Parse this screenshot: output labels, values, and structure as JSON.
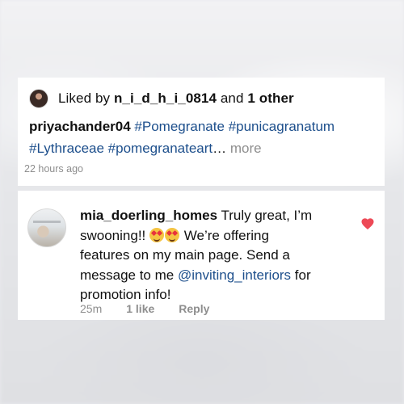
{
  "post": {
    "liked_prefix": "Liked by ",
    "liked_user": "n_i_d_h_i_0814",
    "liked_and": " and ",
    "liked_count": "1 other",
    "caption_user": "priyachander04",
    "caption_tags": [
      "#Pomegranate",
      "#punicagranatum",
      "#Lythraceae",
      "#pomegranateart"
    ],
    "caption_ellipsis": "…",
    "more_label": "more",
    "time": "22 hours ago"
  },
  "comment": {
    "user": "mia_doerling_homes",
    "text_1": "Truly great, I’m swooning!!",
    "emojis": [
      "heart-eyes-emoji",
      "heart-eyes-emoji"
    ],
    "text_2": "We’re offering features on my main page. Send a message to me",
    "mention": "@inviting_interiors",
    "text_3": "for promotion info!",
    "time": "25m",
    "likes": "1 like",
    "reply_label": "Reply",
    "liked": true,
    "heart_color": "#ed4956"
  },
  "colors": {
    "link": "#1d4f8c",
    "muted": "#8e8e8e",
    "text": "#111111"
  }
}
